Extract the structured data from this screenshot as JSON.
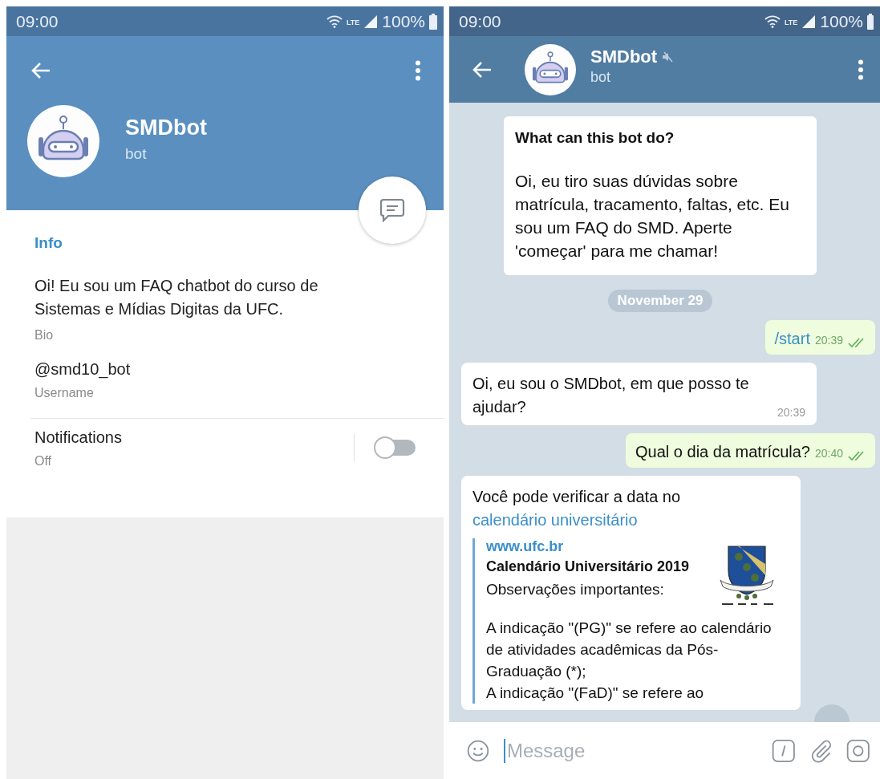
{
  "profile_screen": {
    "status_bar": {
      "time": "09:00",
      "network": "LTE",
      "battery": "100%"
    },
    "header": {
      "name": "SMDbot",
      "subtitle": "bot"
    },
    "info": {
      "heading": "Info",
      "bio": "Oi! Eu sou um FAQ chatbot do curso de Sistemas e Mídias Digitas da UFC.",
      "bio_label": "Bio",
      "username": "@smd10_bot",
      "username_label": "Username"
    },
    "notifications": {
      "label": "Notifications",
      "value": "Off",
      "on": false
    }
  },
  "chat_screen": {
    "status_bar": {
      "time": "09:00",
      "network": "LTE",
      "battery": "100%"
    },
    "header": {
      "name": "SMDbot",
      "subtitle": "bot",
      "muted": true
    },
    "intro_card": {
      "title": "What can this bot do?",
      "text": "Oi, eu tiro suas dúvidas sobre matrícula, tracamento, faltas, etc. Eu sou um FAQ do SMD. Aperte 'começar' para me chamar!"
    },
    "date": "November 29",
    "messages": [
      {
        "kind": "out",
        "text": "/start",
        "time": "20:39",
        "read": true,
        "command": true
      },
      {
        "kind": "in",
        "text": "Oi, eu sou o SMDbot, em que posso te ajudar?",
        "time": "20:39"
      },
      {
        "kind": "out",
        "text": "Qual o dia da matrícula?",
        "time": "20:40",
        "read": true,
        "command": false
      },
      {
        "kind": "link",
        "text": "Você pode verificar a data no",
        "link": "calendário universitário",
        "preview": {
          "site": "www.ufc.br",
          "title": "Calendário Universitário 2019",
          "lines": [
            "Observações importantes:",
            "A indicação \"(PG)\" se refere ao calendário de atividades acadêmicas da Pós-Graduação (*);",
            "A indicação \"(FaD)\" se refere ao"
          ]
        }
      }
    ],
    "input": {
      "placeholder": "Message"
    }
  }
}
